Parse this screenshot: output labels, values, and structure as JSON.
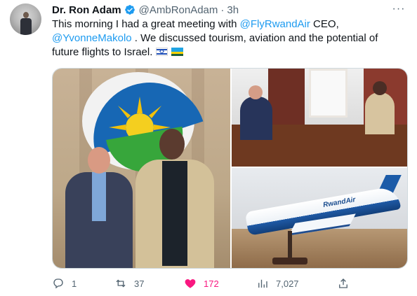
{
  "tweet": {
    "author_name": "Dr. Ron Adam",
    "handle": "@AmbRonAdam",
    "separator": "·",
    "time": "3h",
    "more_label": "···",
    "text_segments": [
      "This morning I had a great meeting with ",
      "@FlyRwandAir",
      " CEO,",
      "@YvonneMakolo",
      " . We discussed tourism, aviation and the potential of future flights to Israel. "
    ],
    "flags": [
      "israel-flag",
      "rwanda-flag"
    ]
  },
  "media": {
    "images": [
      "rwanda-meeting-photo",
      "office-meeting-photo",
      "rwandair-model-photo"
    ],
    "model_label": "RwandAir"
  },
  "actions": {
    "reply_count": "1",
    "retweet_count": "37",
    "like_count": "172",
    "views_count": "7,027"
  },
  "colors": {
    "link": "#1d9bf0",
    "secondary_text": "#536471",
    "like": "#f91880",
    "verified": "#1d9bf0"
  },
  "icons": [
    "verified-icon",
    "reply-icon",
    "retweet-icon",
    "heart-icon",
    "views-icon",
    "share-icon"
  ]
}
